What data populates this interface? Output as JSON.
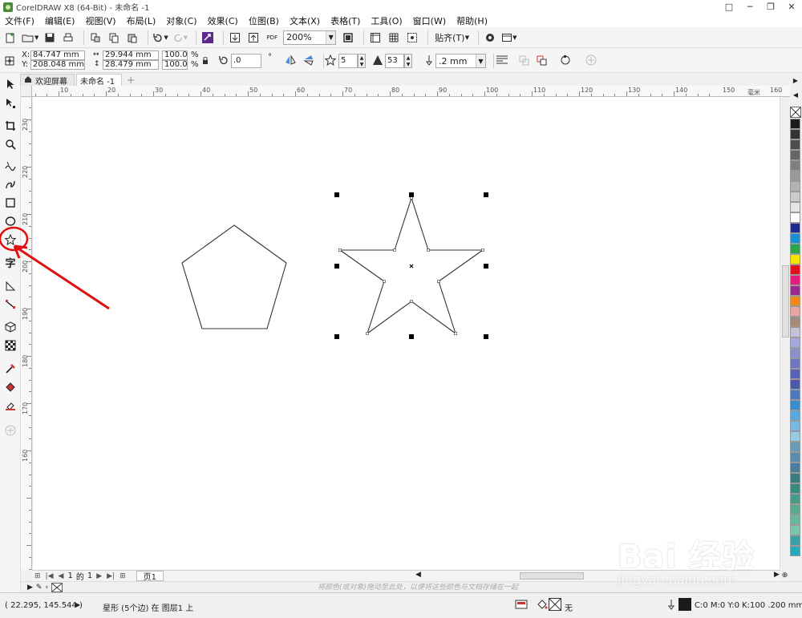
{
  "window": {
    "title": "CorelDRAW X8 (64-Bit) - 未命名 -1",
    "controls": [
      "□",
      "─",
      "❐",
      "✕"
    ]
  },
  "menu": [
    "文件(F)",
    "编辑(E)",
    "视图(V)",
    "布局(L)",
    "对象(C)",
    "效果(C)",
    "位图(B)",
    "文本(X)",
    "表格(T)",
    "工具(O)",
    "窗口(W)",
    "帮助(H)"
  ],
  "toolbar": {
    "zoom": "200%",
    "snap": "贴齐(T)",
    "pdf_label": "PDF"
  },
  "propbar": {
    "x_label": "X:",
    "y_label": "Y:",
    "x": "84.747 mm",
    "y": "208.048 mm",
    "w": "29.944 mm",
    "h": "28.479 mm",
    "sx": "100.0",
    "sy": "100.0",
    "pct": "%",
    "rotation": ".0",
    "degree": "°",
    "points": "5",
    "sharpness": "53",
    "outline": ".2 mm"
  },
  "tabs": {
    "welcome": "欢迎屏幕",
    "doc": "未命名 -1",
    "add": "+"
  },
  "ruler": {
    "h_labels": [
      "10",
      "20",
      "30",
      "40",
      "50",
      "60",
      "70",
      "80",
      "90",
      "100",
      "110",
      "120",
      "130",
      "140",
      "150",
      "160"
    ],
    "h_unit": "毫米",
    "v_labels": [
      "230",
      "220",
      "210",
      "200",
      "190",
      "180",
      "170",
      "160"
    ]
  },
  "pagenav": {
    "current": "1",
    "of": "的",
    "total": "1",
    "page_tab": "页1"
  },
  "hint": "将颜色(或对象)拖动至此处，以便将这些颜色与文档存储在一起",
  "status": {
    "coords": "( 22.295, 145.544 )",
    "object": "星形 (5个边) 在 图层1 上",
    "fill": "无",
    "outline": "C:0 M:0 Y:0 K:100  .200 mm"
  },
  "palette": [
    "#1a1a1a",
    "#333333",
    "#4d4d4d",
    "#666666",
    "#808080",
    "#999999",
    "#b3b3b3",
    "#cccccc",
    "#e6e6e6",
    "#ffffff",
    "#1e2a8c",
    "#1a8fd8",
    "#2aa548",
    "#f5e400",
    "#e01020",
    "#e21c7b",
    "#9c2a8e",
    "#f08a1a",
    "#e7a4a4",
    "#a58a78",
    "#c8c0d8",
    "#a5a8d8",
    "#8a90cc",
    "#6f77c0",
    "#5a62b6",
    "#4e58a8",
    "#4a7bb8",
    "#3b8ccc",
    "#5aa8dc",
    "#7ab8e0",
    "#9cc8e4",
    "#6a9cb4",
    "#5a8cac",
    "#4a7c9c",
    "#3a7c7c",
    "#3a8a7a",
    "#4a9a8a",
    "#5aaa8a",
    "#6ab89c",
    "#7cc6a8",
    "#3aa0a8",
    "#2aa8b8"
  ],
  "watermark": {
    "main": "Bai 经验",
    "sub": "jingyan.baidu.com"
  }
}
